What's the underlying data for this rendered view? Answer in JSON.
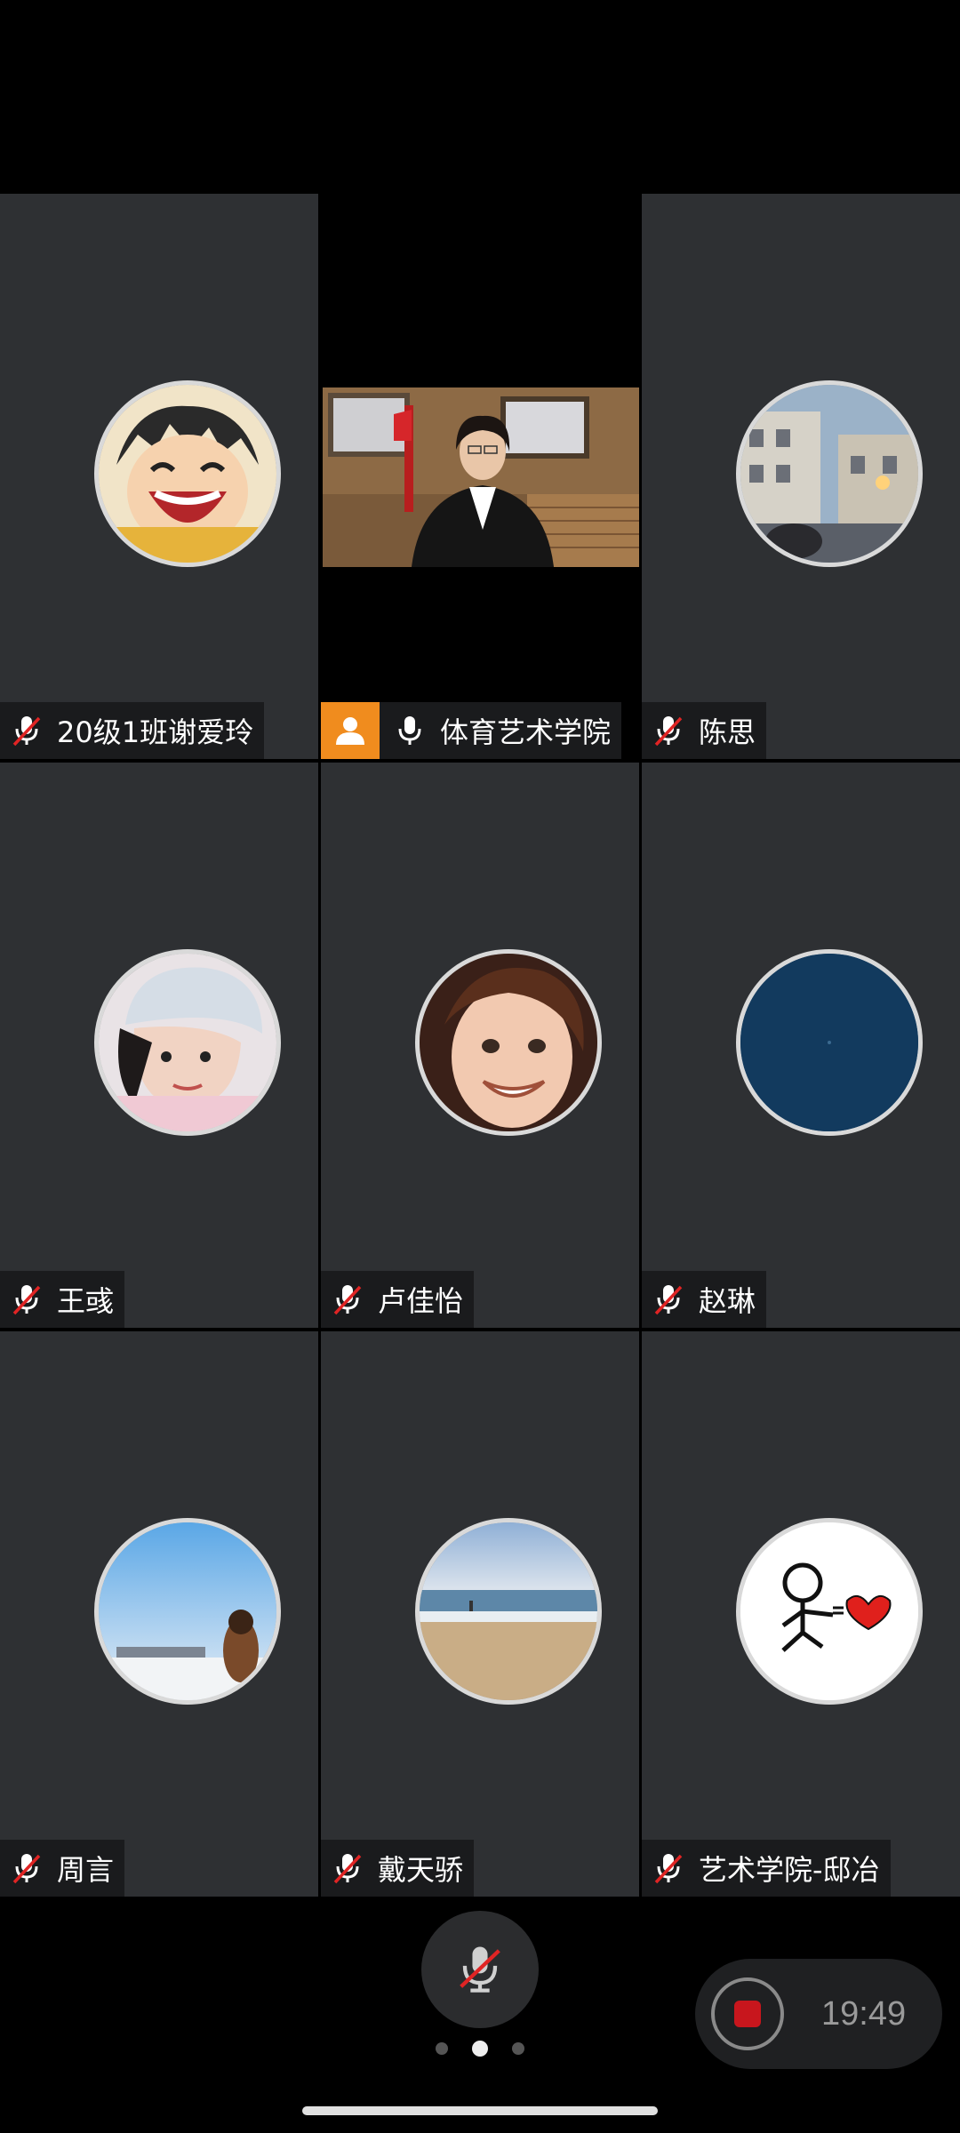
{
  "participants": [
    {
      "name": "20级1班谢爱玲",
      "muted": true,
      "avatar_icon": "anime-boy-avatar"
    },
    {
      "name": "体育艺术学院",
      "muted": false,
      "host": true,
      "video_on": true
    },
    {
      "name": "陈思",
      "muted": true,
      "avatar_icon": "street-photo-avatar"
    },
    {
      "name": "王彧",
      "muted": true,
      "avatar_icon": "girl-hat-avatar"
    },
    {
      "name": "卢佳怡",
      "muted": true,
      "avatar_icon": "child-smile-avatar"
    },
    {
      "name": "赵琳",
      "muted": true,
      "avatar_icon": "dark-blue-avatar"
    },
    {
      "name": "周言",
      "muted": true,
      "avatar_icon": "beach-person-avatar"
    },
    {
      "name": "戴天骄",
      "muted": true,
      "avatar_icon": "sea-shore-avatar"
    },
    {
      "name": "艺术学院-邸冶",
      "muted": true,
      "avatar_icon": "stick-figure-heart-avatar"
    }
  ],
  "controls": {
    "mic_state": "muted",
    "page_count": 3,
    "active_page": 2,
    "recording_time": "19:49"
  },
  "colors": {
    "tile_bg": "#2e3033",
    "host_badge": "#f08c1e",
    "record_red": "#c8161d",
    "muted_slash": "#e02424"
  }
}
